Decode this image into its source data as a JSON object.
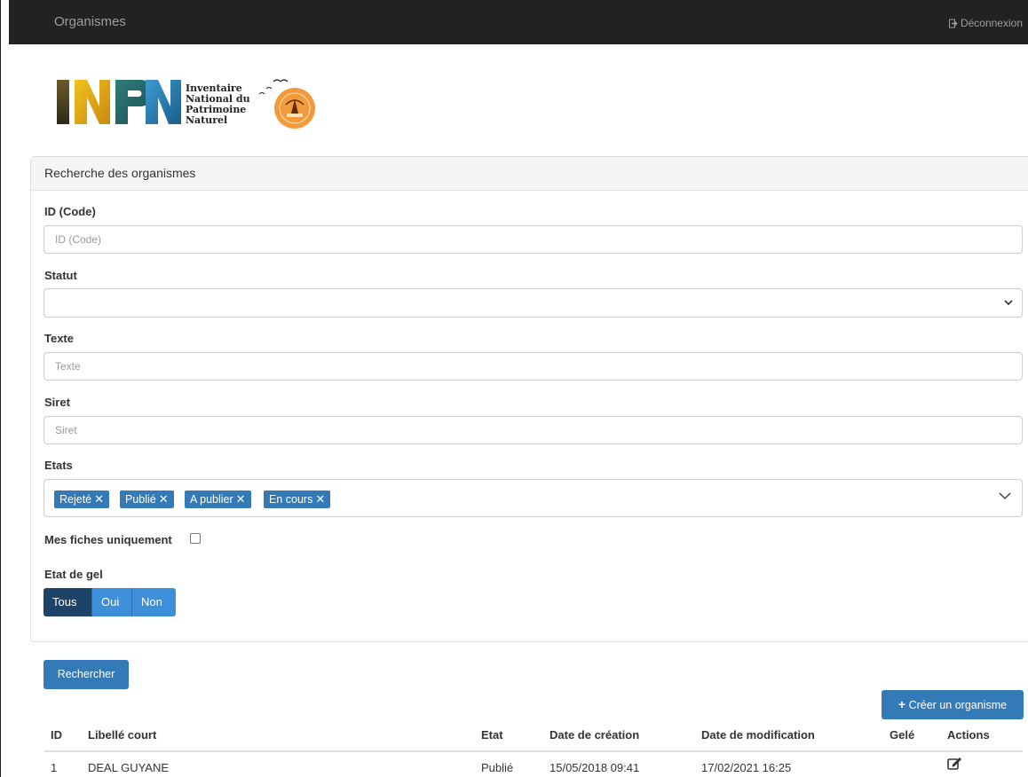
{
  "navbar": {
    "title": "Organismes",
    "logout_label": "Déconnexion"
  },
  "logo": {
    "text_lines": [
      "Inventaire",
      "National du",
      "Patrimoine",
      "Naturel"
    ]
  },
  "search_panel": {
    "heading": "Recherche des organismes",
    "id_label": "ID (Code)",
    "id_placeholder": "ID (Code)",
    "id_value": "",
    "statut_label": "Statut",
    "statut_value": "",
    "texte_label": "Texte",
    "texte_placeholder": "Texte",
    "texte_value": "",
    "siret_label": "Siret",
    "siret_placeholder": "Siret",
    "siret_value": "",
    "etats_label": "Etats",
    "etats_tags": [
      "Rejeté",
      "Publié",
      "A publier",
      "En cours"
    ],
    "mes_fiches_label": "Mes fiches uniquement",
    "mes_fiches_checked": false,
    "gel_label": "Etat de gel",
    "gel_options": [
      "Tous",
      "Oui",
      "Non"
    ],
    "gel_selected": "Tous"
  },
  "search_button_label": "Rechercher",
  "create_button_label": "Créer un organisme",
  "table": {
    "headers": [
      "ID",
      "Libellé court",
      "Etat",
      "Date de création",
      "Date de modification",
      "Gelé",
      "Actions"
    ],
    "rows": [
      {
        "id": "1",
        "libelle": "DEAL GUYANE",
        "etat": "Publié",
        "creation": "15/05/2018 09:41",
        "modification": "17/02/2021 16:25",
        "gele": ""
      }
    ]
  },
  "colors": {
    "navbar": "#222222",
    "primary": "#337ab7",
    "toggle_active": "#1d4468",
    "toggle_idle": "#3d8fd9"
  },
  "icons": {
    "logout": "logout-icon",
    "plus": "plus-icon",
    "edit": "edit-icon",
    "chevron": "chevron-down-icon",
    "tag_remove": "close-icon"
  }
}
